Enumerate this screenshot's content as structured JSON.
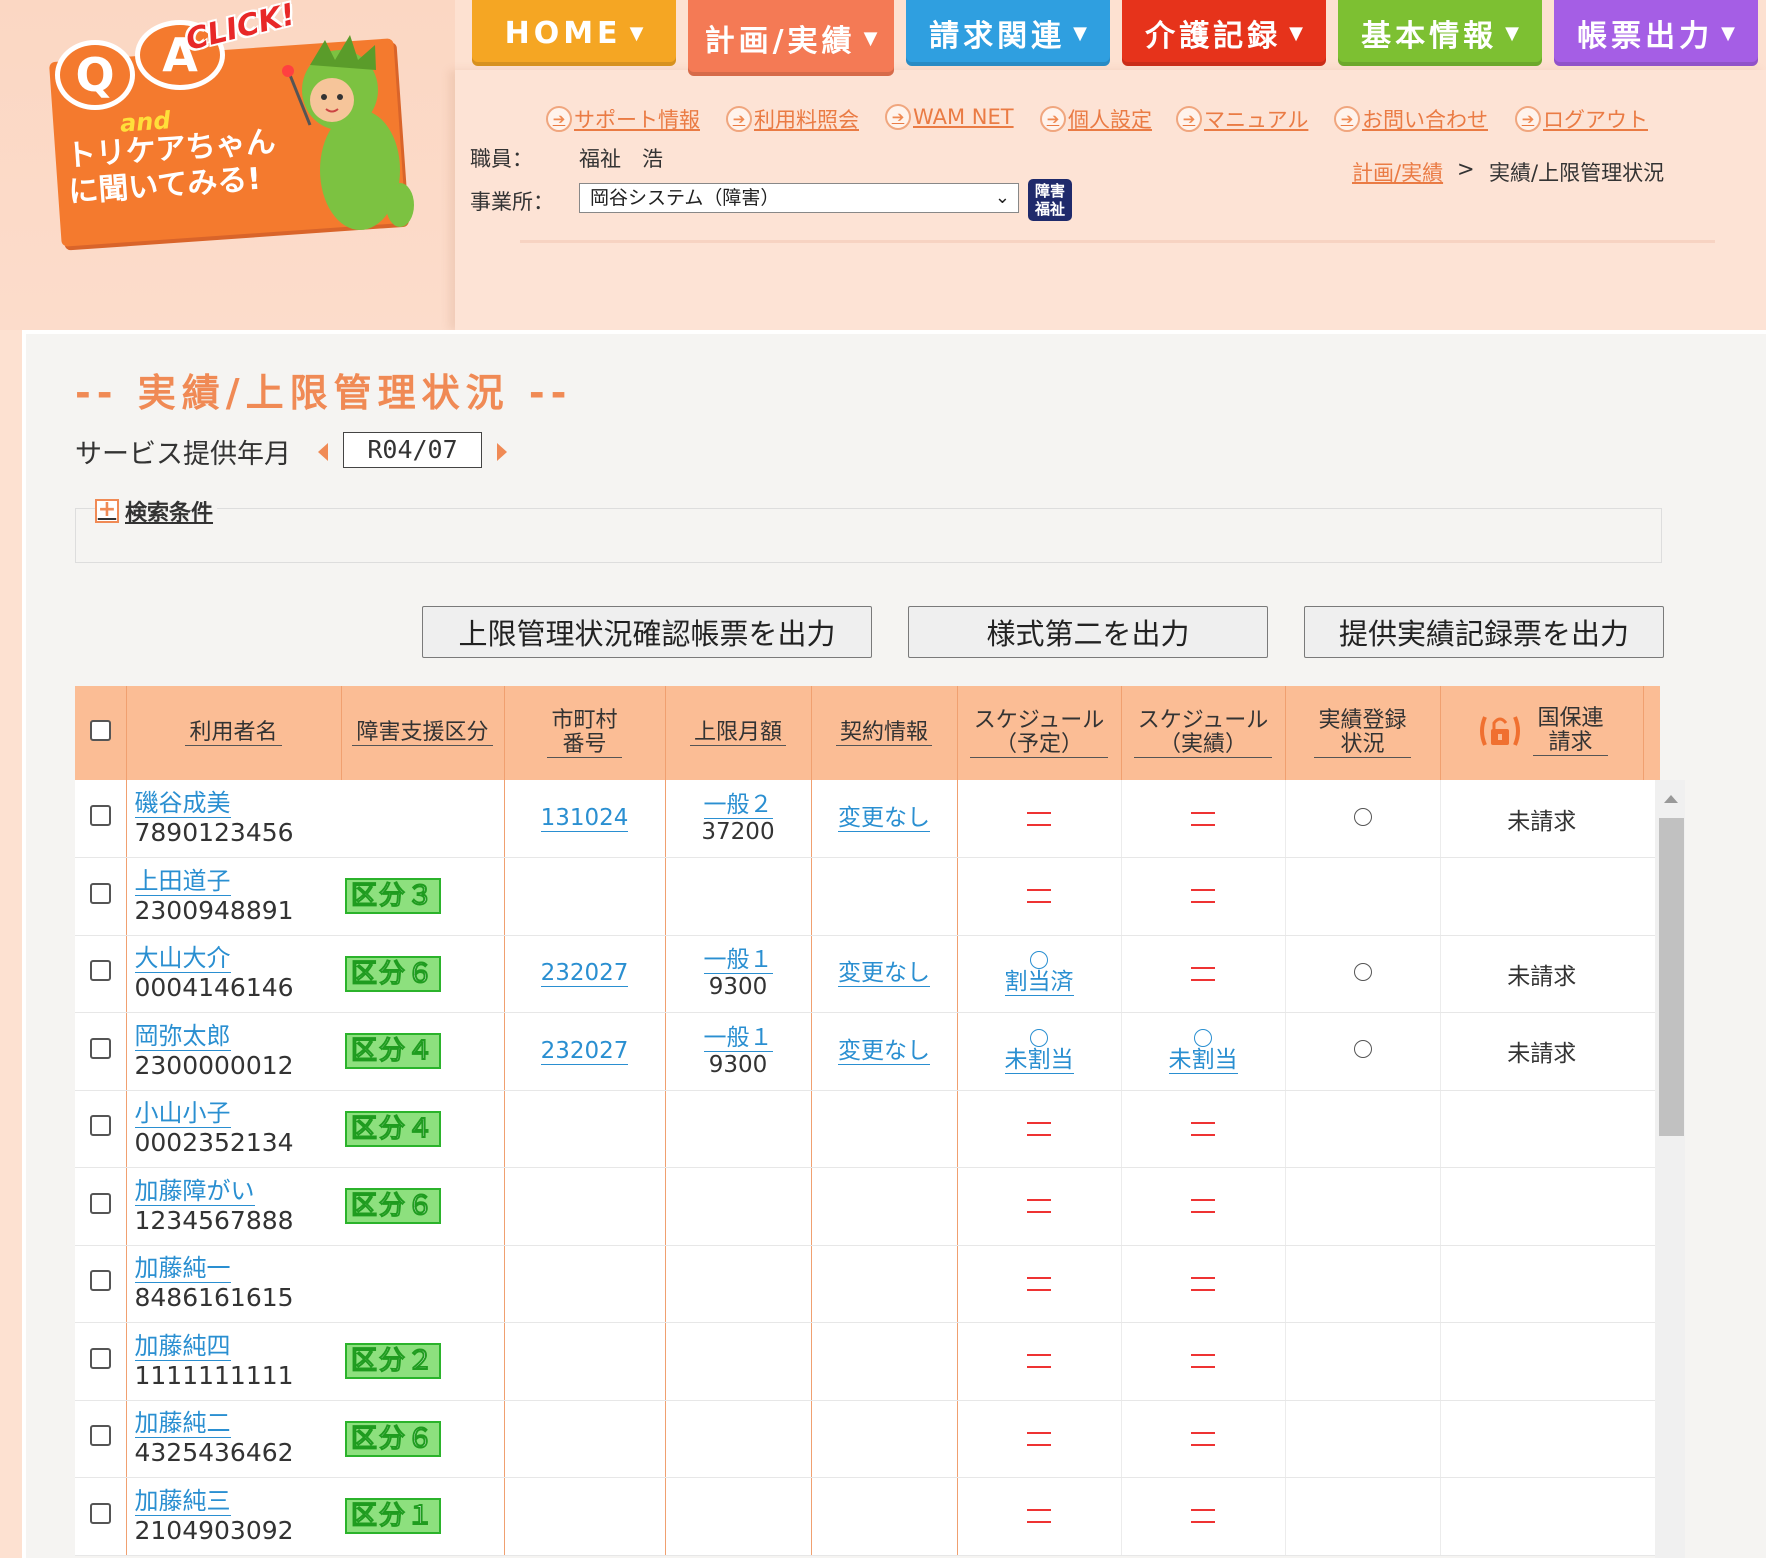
{
  "logo": {
    "q": "Q",
    "a": "A",
    "and": "and",
    "click": "CLICK!",
    "line1": "トリケアちゃん",
    "line2": "に聞いてみる!"
  },
  "nav": [
    {
      "label": "HOME",
      "color": "#f5a623"
    },
    {
      "label": "計画/実績",
      "color": "#f47a55"
    },
    {
      "label": "請求関連",
      "color": "#2f9fe0"
    },
    {
      "label": "介護記録",
      "color": "#e6331b"
    },
    {
      "label": "基本情報",
      "color": "#7dc032"
    },
    {
      "label": "帳票出力",
      "color": "#a55ee5"
    }
  ],
  "top_links": [
    "サポート情報",
    "利用料照会",
    "WAM NET",
    "個人設定",
    "マニュアル",
    "お問い合わせ",
    "ログアウト"
  ],
  "staff": {
    "label": "職員：",
    "value": "福祉　浩"
  },
  "office": {
    "label": "事業所：",
    "value": "岡谷システム（障害）",
    "badge_line1": "障害",
    "badge_line2": "福祉"
  },
  "breadcrumb": {
    "link": "計画/実績",
    "sep": ">",
    "current": "実績/上限管理状況"
  },
  "page_title": "-- 実績/上限管理状況 --",
  "year_month": {
    "label": "サービス提供年月",
    "value": "R04/07"
  },
  "search_toggle": {
    "label": "検索条件"
  },
  "buttons": [
    "上限管理状況確認帳票を出力",
    "様式第二を出力",
    "提供実績記録票を出力"
  ],
  "table": {
    "headers": {
      "name": "利用者名",
      "kubun": "障害支援区分",
      "city_1": "市町村",
      "city_2": "番号",
      "limit": "上限月額",
      "contract": "契約情報",
      "sched_plan_1": "スケジュール",
      "sched_plan_2": "（予定）",
      "sched_actual_1": "スケジュール",
      "sched_actual_2": "（実績）",
      "reg_1": "実績登録",
      "reg_2": "状況",
      "kokuho_1": "国保連",
      "kokuho_2": "請求"
    },
    "rows": [
      {
        "name": "磯谷成美",
        "number": "7890123456",
        "kubun": "",
        "city": "131024",
        "limit_type": "一般２",
        "limit_amount": "37200",
        "contract": "変更なし",
        "plan": {
          "kind": "dash"
        },
        "actual": {
          "kind": "dash"
        },
        "reg": "○",
        "kokuho": "未請求"
      },
      {
        "name": "上田道子",
        "number": "2300948891",
        "kubun": "区分３",
        "city": "",
        "limit_type": "",
        "limit_amount": "",
        "contract": "",
        "plan": {
          "kind": "dash"
        },
        "actual": {
          "kind": "dash"
        },
        "reg": "",
        "kokuho": ""
      },
      {
        "name": "大山大介",
        "number": "0004146146",
        "kubun": "区分６",
        "city": "232027",
        "limit_type": "一般１",
        "limit_amount": "9300",
        "contract": "変更なし",
        "plan": {
          "kind": "status",
          "text": "割当済"
        },
        "actual": {
          "kind": "dash"
        },
        "reg": "○",
        "kokuho": "未請求"
      },
      {
        "name": "岡弥太郎",
        "number": "2300000012",
        "kubun": "区分４",
        "city": "232027",
        "limit_type": "一般１",
        "limit_amount": "9300",
        "contract": "変更なし",
        "plan": {
          "kind": "status",
          "text": "未割当"
        },
        "actual": {
          "kind": "status",
          "text": "未割当"
        },
        "reg": "○",
        "kokuho": "未請求"
      },
      {
        "name": "小山小子",
        "number": "0002352134",
        "kubun": "区分４",
        "city": "",
        "limit_type": "",
        "limit_amount": "",
        "contract": "",
        "plan": {
          "kind": "dash"
        },
        "actual": {
          "kind": "dash"
        },
        "reg": "",
        "kokuho": ""
      },
      {
        "name": "加藤障がい",
        "number": "1234567888",
        "kubun": "区分６",
        "city": "",
        "limit_type": "",
        "limit_amount": "",
        "contract": "",
        "plan": {
          "kind": "dash"
        },
        "actual": {
          "kind": "dash"
        },
        "reg": "",
        "kokuho": ""
      },
      {
        "name": "加藤純一",
        "number": "8486161615",
        "kubun": "",
        "city": "",
        "limit_type": "",
        "limit_amount": "",
        "contract": "",
        "plan": {
          "kind": "dash"
        },
        "actual": {
          "kind": "dash"
        },
        "reg": "",
        "kokuho": ""
      },
      {
        "name": "加藤純四",
        "number": "1111111111",
        "kubun": "区分２",
        "city": "",
        "limit_type": "",
        "limit_amount": "",
        "contract": "",
        "plan": {
          "kind": "dash"
        },
        "actual": {
          "kind": "dash"
        },
        "reg": "",
        "kokuho": ""
      },
      {
        "name": "加藤純二",
        "number": "4325436462",
        "kubun": "区分６",
        "city": "",
        "limit_type": "",
        "limit_amount": "",
        "contract": "",
        "plan": {
          "kind": "dash"
        },
        "actual": {
          "kind": "dash"
        },
        "reg": "",
        "kokuho": ""
      },
      {
        "name": "加藤純三",
        "number": "2104903092",
        "kubun": "区分１",
        "city": "",
        "limit_type": "",
        "limit_amount": "",
        "contract": "",
        "plan": {
          "kind": "dash"
        },
        "actual": {
          "kind": "dash"
        },
        "reg": "",
        "kokuho": ""
      }
    ]
  }
}
